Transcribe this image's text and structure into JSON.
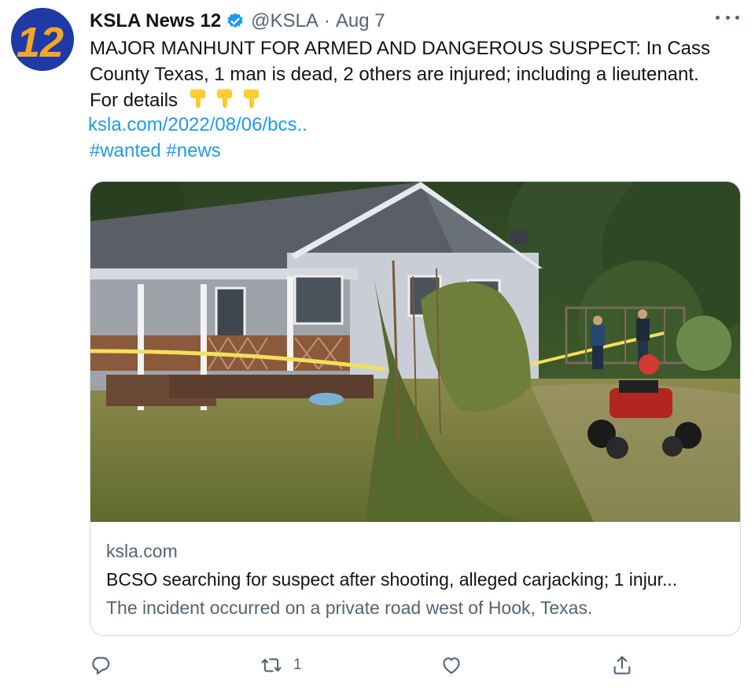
{
  "author": {
    "display_name": "KSLA News 12",
    "handle": "@KSLA",
    "separator": "·",
    "date": "Aug 7",
    "avatar_text": "12",
    "verified": true
  },
  "tweet": {
    "line1": "MAJOR MANHUNT FOR ARMED AND DANGEROUS SUSPECT: In Cass",
    "line2": "County Texas, 1 man is dead, 2 others are injured; including a lieutenant.",
    "line3": "For details",
    "emoji": [
      "backhand-index-pointing-down",
      "backhand-index-pointing-down",
      "backhand-index-pointing-down"
    ],
    "url": "ksla.com/2022/08/06/bcs..",
    "hashtags": [
      "#wanted",
      "#news"
    ]
  },
  "card": {
    "image_alt": "Photo of a white house with a porch wrapped in yellow crime scene tape, investigators in the yard and a red ATV in the grass",
    "domain": "ksla.com",
    "title": "BCSO searching for suspect after shooting, alleged carjacking; 1 injur...",
    "description": "The incident occurred on a private road west of Hook, Texas."
  },
  "actions": {
    "reply_count": "",
    "retweet_count": "1",
    "like_count": "",
    "share_count": ""
  },
  "colors": {
    "link": "#1d9bf0",
    "secondary_text": "#536471",
    "primary_text": "#0f1419",
    "border": "#cfd9de",
    "avatar_bg": "#1f3aa6",
    "avatar_text": "#f5a623",
    "verified": "#1d9bf0"
  },
  "icons": [
    "more-icon",
    "verified-badge-icon",
    "reply-icon",
    "retweet-icon",
    "like-icon",
    "share-icon"
  ]
}
